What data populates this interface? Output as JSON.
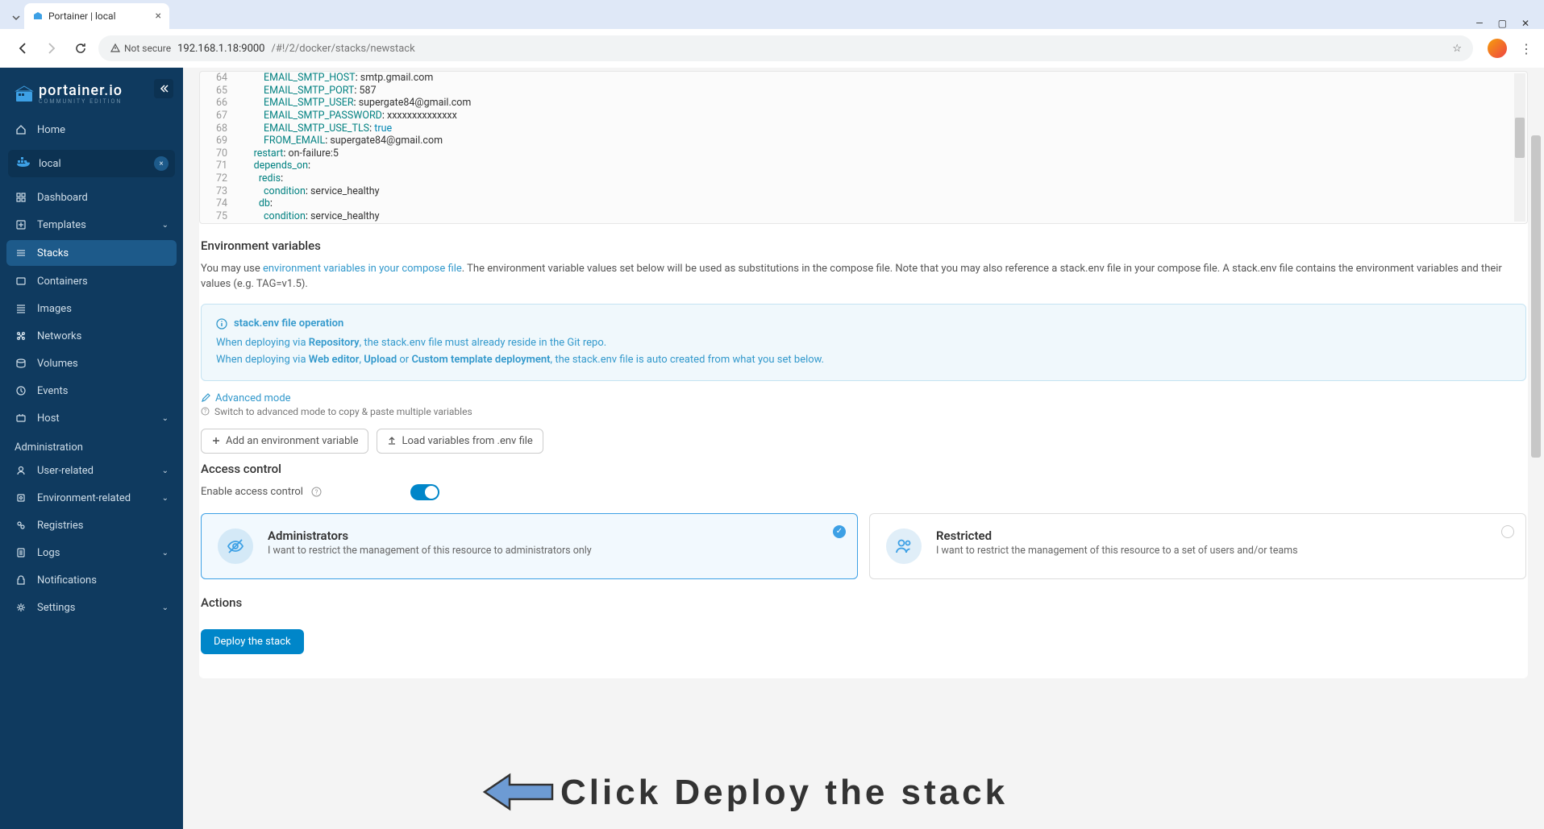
{
  "browser": {
    "tab_title": "Portainer | local",
    "url_security": "Not secure",
    "url_host": "192.168.1.18:9000",
    "url_path": "/#!/2/docker/stacks/newstack"
  },
  "logo": {
    "name": "portainer.io",
    "edition": "COMMUNITY EDITION"
  },
  "sidebar": {
    "home": "Home",
    "env_name": "local",
    "items": [
      {
        "label": "Dashboard"
      },
      {
        "label": "Templates",
        "expandable": true
      },
      {
        "label": "Stacks",
        "active": true
      },
      {
        "label": "Containers"
      },
      {
        "label": "Images"
      },
      {
        "label": "Networks"
      },
      {
        "label": "Volumes"
      },
      {
        "label": "Events"
      },
      {
        "label": "Host",
        "expandable": true
      }
    ],
    "admin_label": "Administration",
    "admin_items": [
      {
        "label": "User-related",
        "expandable": true
      },
      {
        "label": "Environment-related",
        "expandable": true
      },
      {
        "label": "Registries"
      },
      {
        "label": "Logs",
        "expandable": true
      },
      {
        "label": "Notifications"
      },
      {
        "label": "Settings",
        "expandable": true
      }
    ]
  },
  "code": [
    {
      "n": 64,
      "indent": 5,
      "key": "EMAIL_SMTP_HOST",
      "sep": ": ",
      "val": "smtp.gmail.com"
    },
    {
      "n": 65,
      "indent": 5,
      "key": "EMAIL_SMTP_PORT",
      "sep": ": ",
      "val": "587"
    },
    {
      "n": 66,
      "indent": 5,
      "key": "EMAIL_SMTP_USER",
      "sep": ": ",
      "val": "supergate84@gmail.com"
    },
    {
      "n": 67,
      "indent": 5,
      "key": "EMAIL_SMTP_PASSWORD",
      "sep": ": ",
      "val": "xxxxxxxxxxxxxx"
    },
    {
      "n": 68,
      "indent": 5,
      "key": "EMAIL_SMTP_USE_TLS",
      "sep": ": ",
      "val": "true",
      "bool": true
    },
    {
      "n": 69,
      "indent": 5,
      "key": "FROM_EMAIL",
      "sep": ": ",
      "val": "supergate84@gmail.com"
    },
    {
      "n": 70,
      "indent": 3,
      "key": "restart",
      "sep": ": ",
      "val": "on-failure:5"
    },
    {
      "n": 71,
      "indent": 3,
      "key": "depends_on",
      "sep": ":",
      "val": ""
    },
    {
      "n": 72,
      "indent": 4,
      "key": "redis",
      "sep": ":",
      "val": ""
    },
    {
      "n": 73,
      "indent": 5,
      "key": "condition",
      "sep": ": ",
      "val": "service_healthy"
    },
    {
      "n": 74,
      "indent": 4,
      "key": "db",
      "sep": ":",
      "val": ""
    },
    {
      "n": 75,
      "indent": 5,
      "key": "condition",
      "sep": ": ",
      "val": "service_healthy"
    }
  ],
  "env": {
    "title": "Environment variables",
    "text1": "You may use ",
    "link1": "environment variables in your compose file",
    "text2": ". The environment variable values set below will be used as substitutions in the compose file. Note that you may also reference a stack.env file in your compose file. A stack.env file contains the environment variables and their values (e.g. TAG=v1.5).",
    "info_title": "stack.env file operation",
    "info_line1a": "When deploying via ",
    "info_line1b": "Repository",
    "info_line1c": ", the stack.env file must already reside in the Git repo.",
    "info_line2a": "When deploying via ",
    "info_line2b": "Web editor",
    "info_line2c": ", ",
    "info_line2d": "Upload",
    "info_line2e": " or ",
    "info_line2f": "Custom template deployment",
    "info_line2g": ", the stack.env file is auto created from what you set below.",
    "adv_mode": "Advanced mode",
    "adv_hint": "Switch to advanced mode to copy & paste multiple variables",
    "btn_add": "Add an environment variable",
    "btn_load": "Load variables from .env file"
  },
  "access": {
    "title": "Access control",
    "enable_label": "Enable access control",
    "admin_title": "Administrators",
    "admin_desc": "I want to restrict the management of this resource to administrators only",
    "restricted_title": "Restricted",
    "restricted_desc": "I want to restrict the management of this resource to a set of users and/or teams"
  },
  "actions": {
    "title": "Actions",
    "deploy": "Deploy the stack"
  },
  "annotation": "Click Deploy the stack"
}
